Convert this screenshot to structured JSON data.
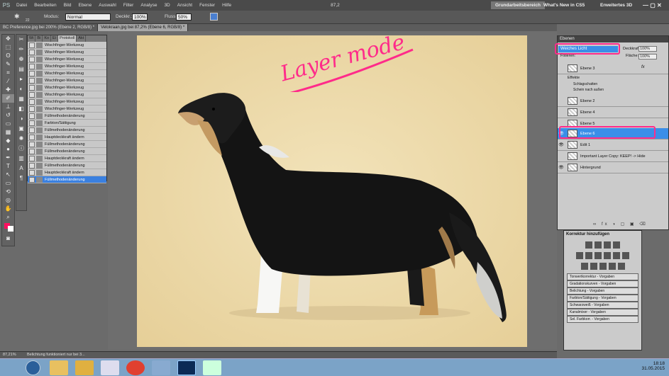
{
  "app": {
    "logo": "PS"
  },
  "menu": [
    "Datei",
    "Bearbeiten",
    "Bild",
    "Ebene",
    "Auswahl",
    "Filter",
    "Analyse",
    "3D",
    "Ansicht",
    "Fenster",
    "Hilfe"
  ],
  "zoom_menu": "87,2",
  "workspaces": {
    "active": "Grundarbeitsbereich",
    "whats_new": "What's New in CS5",
    "advanced": "Erweitertes 3D"
  },
  "options": {
    "brush_size": "22",
    "mode_label": "Modus:",
    "mode_value": "Normal",
    "opacity_label": "Deckkr.:",
    "opacity_value": "100%",
    "flow_label": "Fluss:",
    "flow_value": "50%"
  },
  "documents": [
    {
      "title": "BC Preference.jpg bei 200% (Ebene 2, RGB/8) *",
      "active": false
    },
    {
      "title": "Velokraan.jpg bei 87,2% (Ebene 6, RGB/8) *",
      "active": true
    }
  ],
  "history": {
    "tabs": [
      "Wi",
      "Bi",
      "Ko",
      "Ei",
      "Protokoll",
      "Akt"
    ],
    "items": [
      {
        "label": "Wischfinger-Werkzeug",
        "selected": false
      },
      {
        "label": "Wischfinger-Werkzeug",
        "selected": false
      },
      {
        "label": "Wischfinger-Werkzeug",
        "selected": false
      },
      {
        "label": "Wischfinger-Werkzeug",
        "selected": false
      },
      {
        "label": "Wischfinger-Werkzeug",
        "selected": false
      },
      {
        "label": "Wischfinger-Werkzeug",
        "selected": false
      },
      {
        "label": "Wischfinger-Werkzeug",
        "selected": false
      },
      {
        "label": "Wischfinger-Werkzeug",
        "selected": false
      },
      {
        "label": "Wischfinger-Werkzeug",
        "selected": false
      },
      {
        "label": "Wischfinger-Werkzeug",
        "selected": false
      },
      {
        "label": "Füllmethodenänderung",
        "selected": false
      },
      {
        "label": "Farbton/Sättigung",
        "selected": false
      },
      {
        "label": "Füllmethodenänderung",
        "selected": false
      },
      {
        "label": "Hauptdeckkraft ändern",
        "selected": false
      },
      {
        "label": "Füllmethodenänderung",
        "selected": false
      },
      {
        "label": "Füllmethodenänderung",
        "selected": false
      },
      {
        "label": "Hauptdeckkraft ändern",
        "selected": false
      },
      {
        "label": "Füllmethodenänderung",
        "selected": false
      },
      {
        "label": "Hauptdeckkraft ändern",
        "selected": false
      },
      {
        "label": "Füllmethodenänderung",
        "selected": true
      }
    ]
  },
  "annotation": "Layer mode",
  "layers_panel": {
    "title": "Ebenen",
    "blend_mode": "Weiches Licht",
    "opacity_label": "Deckkraft:",
    "opacity": "100%",
    "fixieren_label": "Fixieren:",
    "fill_label": "Fläche:",
    "fill": "100%",
    "fx_label": "fx",
    "effekte_label": "Effekte",
    "effect_items": [
      "Schlagschatten",
      "Schein nach außen"
    ],
    "layers": [
      {
        "name": "Ebene 3",
        "visible": false,
        "selected": false
      },
      {
        "name": "Ebene 2",
        "visible": false,
        "selected": false
      },
      {
        "name": "Ebene 4",
        "visible": false,
        "selected": false
      },
      {
        "name": "Ebene 5",
        "visible": false,
        "selected": false
      },
      {
        "name": "Ebene 6",
        "visible": true,
        "selected": true
      },
      {
        "name": "Edit 1",
        "visible": true,
        "selected": false
      },
      {
        "name": "Important Layer Copy: KEEP! -> Hide",
        "visible": false,
        "selected": false
      },
      {
        "name": "Hintergrund",
        "visible": true,
        "selected": false
      }
    ]
  },
  "korrektur": {
    "title": "Korrektur hinzufügen",
    "presets": [
      "Tonwertkorrektur - Vorgaben",
      "Gradationskurven - Vorgaben",
      "Belichtung - Vorgaben",
      "Farbton/Sättigung - Vorgaben",
      "Schwarzweiß - Vorgaben",
      "Kanalmixer - Vorgaben",
      "Sel. Farbkorr. - Vorgaben"
    ]
  },
  "status": {
    "zoom": "87,21%",
    "message": "Belichtung funktioniert nur bei 3..."
  },
  "taskbar": {
    "time": "18:18",
    "date": "31.05.2015"
  },
  "colors": {
    "accent_pink": "#ff2b8a",
    "selection_blue": "#3a8ee8",
    "canvas_bg": "#efdeb0"
  }
}
